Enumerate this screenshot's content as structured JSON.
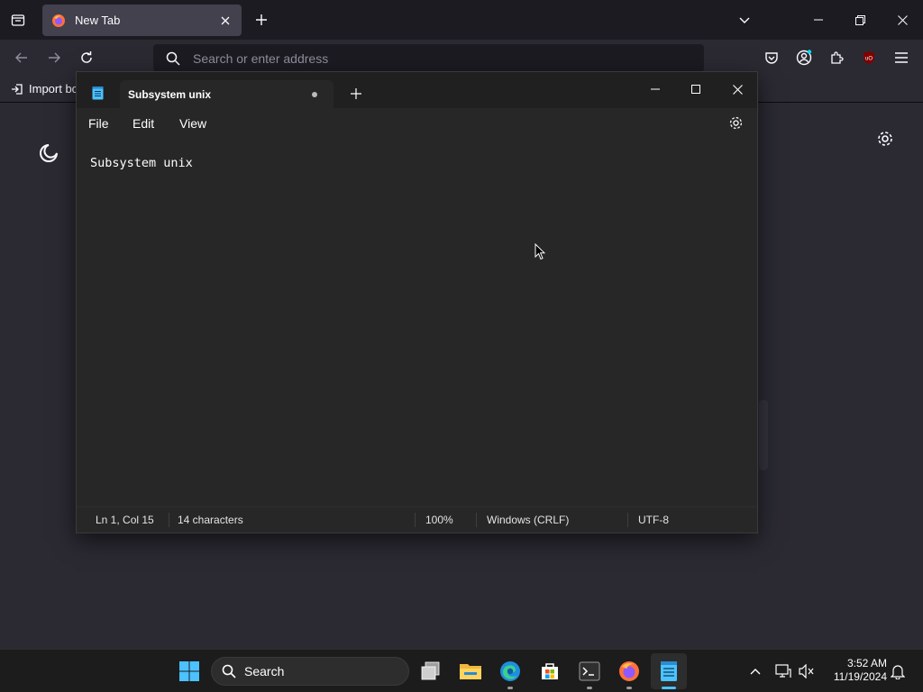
{
  "browser": {
    "tab_title": "New Tab",
    "search_placeholder": "Search or enter address",
    "bookmark_import_label": "Import bo"
  },
  "notepad": {
    "tab_title": "Subsystem unix",
    "menu": [
      "File",
      "Edit",
      "View"
    ],
    "content": "Subsystem unix",
    "status": {
      "position": "Ln 1, Col 15",
      "characters": "14 characters",
      "zoom": "100%",
      "line_endings": "Windows (CRLF)",
      "encoding": "UTF-8"
    }
  },
  "taskbar": {
    "search_label": "Search",
    "time": "3:52 AM",
    "date": "11/19/2024"
  },
  "colors": {
    "accent": "#4cc2ff",
    "notepad_bg": "#272727",
    "browser_bg": "#2b2a33"
  }
}
